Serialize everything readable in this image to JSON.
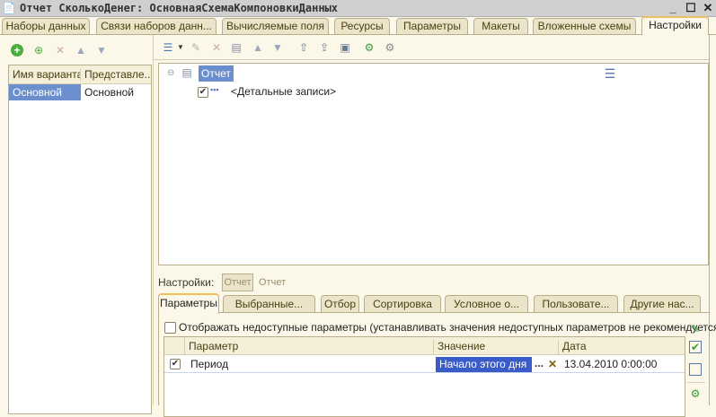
{
  "window": {
    "title": "Отчет СколькоДенег: ОсновнаяСхемаКомпоновкиДанных",
    "minimize": "_",
    "maximize": "☐",
    "close": "✕"
  },
  "tabs": [
    {
      "label": "Наборы данных"
    },
    {
      "label": "Связи наборов данн..."
    },
    {
      "label": "Вычисляемые поля"
    },
    {
      "label": "Ресурсы"
    },
    {
      "label": "Параметры"
    },
    {
      "label": "Макеты"
    },
    {
      "label": "Вложенные схемы"
    },
    {
      "label": "Настройки"
    }
  ],
  "variants": {
    "columns": [
      "Имя варианта",
      "Представле..."
    ],
    "rows": [
      [
        "Основной",
        "Основной"
      ]
    ]
  },
  "tree": {
    "root": "Отчет",
    "child": "<Детальные записи>"
  },
  "settings": {
    "label": "Настройки:",
    "button": "Отчет",
    "current": "Отчет"
  },
  "subtabs": [
    {
      "label": "Параметры"
    },
    {
      "label": "Выбранные..."
    },
    {
      "label": "Отбор"
    },
    {
      "label": "Сортировка"
    },
    {
      "label": "Условное о..."
    },
    {
      "label": "Пользовате..."
    },
    {
      "label": "Другие нас..."
    }
  ],
  "params": {
    "show_unavailable": "Отображать недоступные параметры (устанавливать значения недоступных параметров не рекомендуется)",
    "columns": [
      "Параметр",
      "Значение",
      "Дата"
    ],
    "rows": [
      {
        "checked": true,
        "name": "Период",
        "value": "Начало этого дня",
        "date": "13.04.2010 0:00:00"
      }
    ],
    "ellipsis": "...",
    "clear": "✕"
  },
  "colors": {
    "selection": "#6b8fcc",
    "value_selection": "#3a5cc8",
    "cream": "#fbf8e9"
  }
}
